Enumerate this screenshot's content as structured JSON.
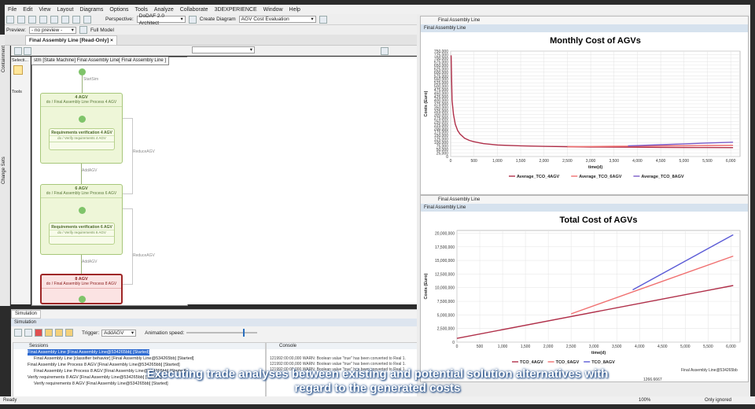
{
  "menu": [
    "File",
    "Edit",
    "View",
    "Layout",
    "Diagrams",
    "Options",
    "Tools",
    "Analyze",
    "Collaborate",
    "3DEXPERIENCE",
    "Window",
    "Help"
  ],
  "toolbar": {
    "perspective_label": "Perspective:",
    "perspective_value": "DoDAF 2.0 Architect",
    "create_diagram": "Create Diagram",
    "diagram_select": "AGV Cost Evaluation",
    "preview_label": "Preview:",
    "preview_value": "- no preview -",
    "full_model": "Full Model"
  },
  "editor_tab": "Final Assembly Line [Read-Only]",
  "left_rail": {
    "containment": "Containment",
    "change_sets": "Change Sets"
  },
  "palette": {
    "selection": "Selecti...",
    "tools": "Tools"
  },
  "diagram": {
    "frame_label": "stm [State Machine] Final Assembly Line[ Final Assembly Line ]",
    "start_label": "StartSim",
    "states": [
      {
        "name": "4 AGV",
        "do": "do / Final Assembly Line Process 4 AGV",
        "sub": "Requirements verification 4 AGV",
        "subdo": "do / Verify requirements 4 AGV"
      },
      {
        "name": "6 AGV",
        "do": "do / Final Assembly Line Process 6 AGV",
        "sub": "Requirements verification 6 AGV",
        "subdo": "do / Verify requirements 6 AGV"
      },
      {
        "name": "8 AGV",
        "do": "do / Final Assembly Line Process 8 AGV"
      }
    ],
    "add_label": "AddAGV",
    "reduce_label": "ReduceAGV"
  },
  "simulation": {
    "tab": "Simulation",
    "header": "Simulation",
    "trigger_label": "Trigger:",
    "trigger_value": "AddAGV",
    "speed_label": "Animation speed:",
    "sessions_tab": "Sessions",
    "console_tab": "Console",
    "sessions": [
      "Final Assembly Line [Final Assembly Line@534265bb] [Started]",
      "Final Assembly Line [classifier behavior] [Final Assembly Line@534265bb] [Started]",
      "Final Assembly Line Process 8 AGV [Final Assembly Line@534265bb] [Started]",
      "Final Assembly Line Process 8 AGV [Final Assembly Line@534265bb] [Started]",
      "Verify requirements 8 AGV [Final Assembly Line@534265bb] [Started]",
      "Verify requirements 8 AGV [Final Assembly Line@534265bb] [Started]"
    ],
    "console": [
      "121992:00:00,000 WARN: Boolean value \"true\" has been converted to Real 1.",
      "121992:00:00,000 WARN: Boolean value \"true\" has been converted to Real 1.",
      "121992:00:00,000 WARN: Boolean value \"true\" has been converted to Real 1."
    ],
    "side_values": [
      "Final Assembly Line@534265bb",
      "1266.6667"
    ]
  },
  "monthly_window": {
    "tab": "Final Assembly Line",
    "title": "Final Assembly Line"
  },
  "total_window": {
    "tab": "Final Assembly Line",
    "title": "Final Assembly Line"
  },
  "status": {
    "left": "Ready",
    "zoom": "100%",
    "right": "Only ignored"
  },
  "caption": [
    "Executing trade analyses between existing and potential solution alternatives with",
    "regard to the generated costs"
  ],
  "chart_data": [
    {
      "type": "line",
      "title": "Monthly Cost of AGVs",
      "xlabel": "time(d)",
      "ylabel": "Costs (Euro)",
      "xlim": [
        0,
        6200
      ],
      "ylim": [
        0,
        750000
      ],
      "xticks": [
        0,
        500,
        1000,
        1500,
        2000,
        2500,
        3000,
        3500,
        4000,
        4500,
        5000,
        5500,
        6000
      ],
      "xtick_labels": [
        "0",
        "500",
        "1,000",
        "1,500",
        "2,000",
        "2,500",
        "3,000",
        "3,500",
        "4,000",
        "4,500",
        "5,000",
        "5,500",
        "6,000"
      ],
      "yticks": [
        0,
        25000,
        50000,
        75000,
        100000,
        125000,
        150000,
        175000,
        200000,
        225000,
        250000,
        275000,
        300000,
        325000,
        350000,
        375000,
        400000,
        425000,
        450000,
        475000,
        500000,
        525000,
        550000,
        575000,
        600000,
        625000,
        650000,
        675000,
        700000,
        725000,
        750000
      ],
      "ytick_labels": [
        "0",
        "25,000",
        "50,000",
        "75,000",
        "100,000",
        "125,000",
        "150,000",
        "175,000",
        "200,000",
        "225,000",
        "250,000",
        "275,000",
        "300,000",
        "325,000",
        "350,000",
        "375,000",
        "400,000",
        "425,000",
        "450,000",
        "475,000",
        "500,000",
        "525,000",
        "550,000",
        "575,000",
        "600,000",
        "625,000",
        "650,000",
        "675,000",
        "700,000",
        "725,000",
        "750,000"
      ],
      "grid": true,
      "legend_position": "bottom",
      "series": [
        {
          "name": "Average_TCO_4AGV",
          "color": "#b0304a",
          "x": [
            10,
            30,
            60,
            100,
            150,
            200,
            300,
            400,
            500,
            700,
            1000,
            1500,
            2000,
            2500,
            3000,
            3500,
            4000,
            4500,
            5000,
            5500,
            6050
          ],
          "y": [
            720000,
            400000,
            300000,
            230000,
            185000,
            160000,
            130000,
            115000,
            105000,
            92000,
            82000,
            76000,
            72000,
            70000,
            68000,
            67000,
            66000,
            65000,
            64500,
            64000,
            63500
          ]
        },
        {
          "name": "Average_TCO_6AGV",
          "color": "#f07070",
          "x": [
            2500,
            3000,
            3500,
            4000,
            4500,
            5000,
            5500,
            6050
          ],
          "y": [
            70000,
            71000,
            72500,
            74000,
            75500,
            77000,
            78500,
            80000
          ]
        },
        {
          "name": "Average_TCO_8AGV",
          "color": "#7a5cc8",
          "x": [
            3800,
            4000,
            4500,
            5000,
            5500,
            6050
          ],
          "y": [
            76000,
            78000,
            84000,
            90000,
            96000,
            102000
          ]
        }
      ]
    },
    {
      "type": "line",
      "title": "Total Cost of AGVs",
      "xlabel": "time(d)",
      "ylabel": "Costs (Euro)",
      "xlim": [
        0,
        6200
      ],
      "ylim": [
        0,
        20500000
      ],
      "xticks": [
        0,
        500,
        1000,
        1500,
        2000,
        2500,
        3000,
        3500,
        4000,
        4500,
        5000,
        5500,
        6000
      ],
      "xtick_labels": [
        "0",
        "500",
        "1,000",
        "1,500",
        "2,000",
        "2,500",
        "3,000",
        "3,500",
        "4,000",
        "4,500",
        "5,000",
        "5,500",
        "6,000"
      ],
      "yticks": [
        0,
        2500000,
        5000000,
        7500000,
        10000000,
        12500000,
        15000000,
        17500000,
        20000000
      ],
      "ytick_labels": [
        "0",
        "2,500,000",
        "5,000,000",
        "7,500,000",
        "10,000,000",
        "12,500,000",
        "15,000,000",
        "17,500,000",
        "20,000,000"
      ],
      "grid": true,
      "legend_position": "bottom",
      "series": [
        {
          "name": "TCO_4AGV",
          "color": "#b0304a",
          "x": [
            0,
            6050
          ],
          "y": [
            700000,
            10400000
          ]
        },
        {
          "name": "TCO_6AGV",
          "color": "#f07070",
          "x": [
            2500,
            6050
          ],
          "y": [
            5200000,
            15800000
          ]
        },
        {
          "name": "TCO_8AGV",
          "color": "#5b5bd6",
          "x": [
            3850,
            6050
          ],
          "y": [
            9600000,
            19700000
          ]
        }
      ]
    }
  ]
}
